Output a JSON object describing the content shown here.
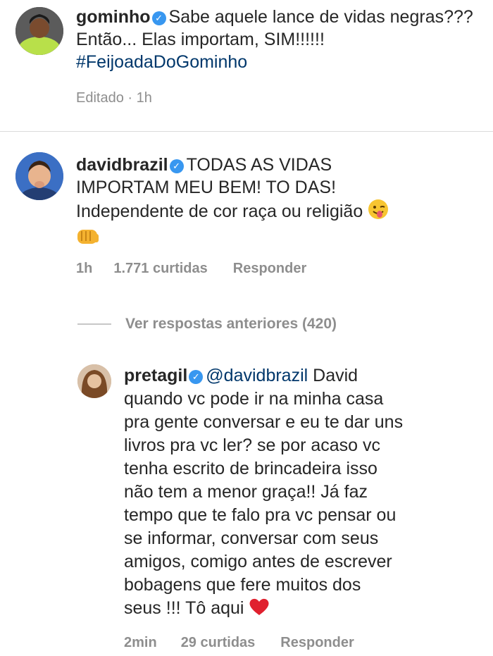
{
  "comments": [
    {
      "username": "gominho",
      "text": "Sabe aquele lance de vidas negras??? Então... Elas importam, SIM!!!!!!",
      "hashtag": "#FeijoadaDoGominho",
      "edited": "Editado",
      "time": "1h"
    },
    {
      "username": "davidbrazil",
      "text_line1": "TODAS AS VIDAS",
      "text_line2": "IMPORTAM MEU BEM! TO DAS!",
      "text_line3": "Independente de cor raça ou religião",
      "time": "1h",
      "likes": "1.771 curtidas",
      "reply": "Responder"
    }
  ],
  "view_previous": "Ver respostas anteriores (420)",
  "reply": {
    "username": "pretagil",
    "mention": "@davidbrazil",
    "lines": [
      "David",
      "quando vc pode ir na minha casa",
      "pra gente conversar e eu te dar uns",
      "livros pra vc ler? se por acaso vc",
      "tenha escrito de brincadeira isso",
      "não tem a menor graça!! Já faz",
      "tempo que te falo pra vc pensar ou",
      "se informar, conversar com seus",
      "amigos, comigo antes de escrever",
      "bobagens que fere muitos dos",
      "seus !!! Tô aqui"
    ],
    "time": "2min",
    "likes": "29 curtidas",
    "reply_label": "Responder"
  },
  "icons": {
    "verified": "verified-badge-icon",
    "wink": "winking-tongue-emoji",
    "fist": "oncoming-fist-emoji",
    "heart": "red-heart-emoji"
  },
  "colors": {
    "verified": "#3897f0",
    "link": "#00376b",
    "meta": "#8e8e8e"
  }
}
